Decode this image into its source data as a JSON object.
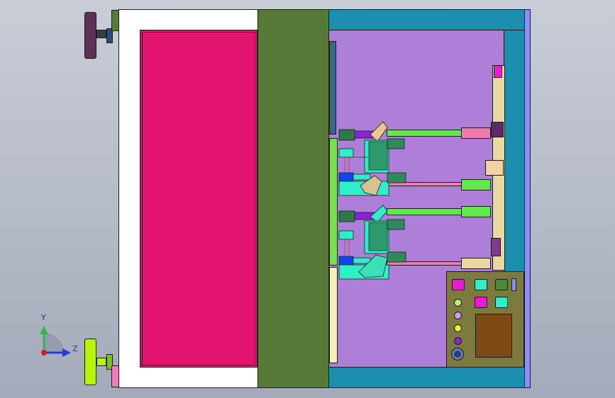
{
  "viewport": {
    "background": "#b8bdc9",
    "orientation_triad": {
      "y_axis_label": "Y",
      "z_axis_label": "Z",
      "y_color": "#2db84c",
      "z_color": "#1f3fd6",
      "origin_color": "#d21f1f"
    }
  },
  "model": {
    "door_panel_color": "#e3146f",
    "door_frame_color": "#ffffff",
    "divider_color": "#577a38",
    "cabinet_interior_color": "#ad7fd9",
    "cabinet_frame_color": "#1c8fae",
    "side_rail_color": "#8e8ff0",
    "handle_top_color": "#5b3155",
    "handle_bottom_color": "#b6f40e",
    "control_panel_color": "#7c7a3f",
    "control_screen_color": "#7f4a13",
    "fixture_accent_colors": [
      "#2ef0c8",
      "#8a22d8",
      "#0f46f0",
      "#61e84a",
      "#f17bb0"
    ]
  }
}
